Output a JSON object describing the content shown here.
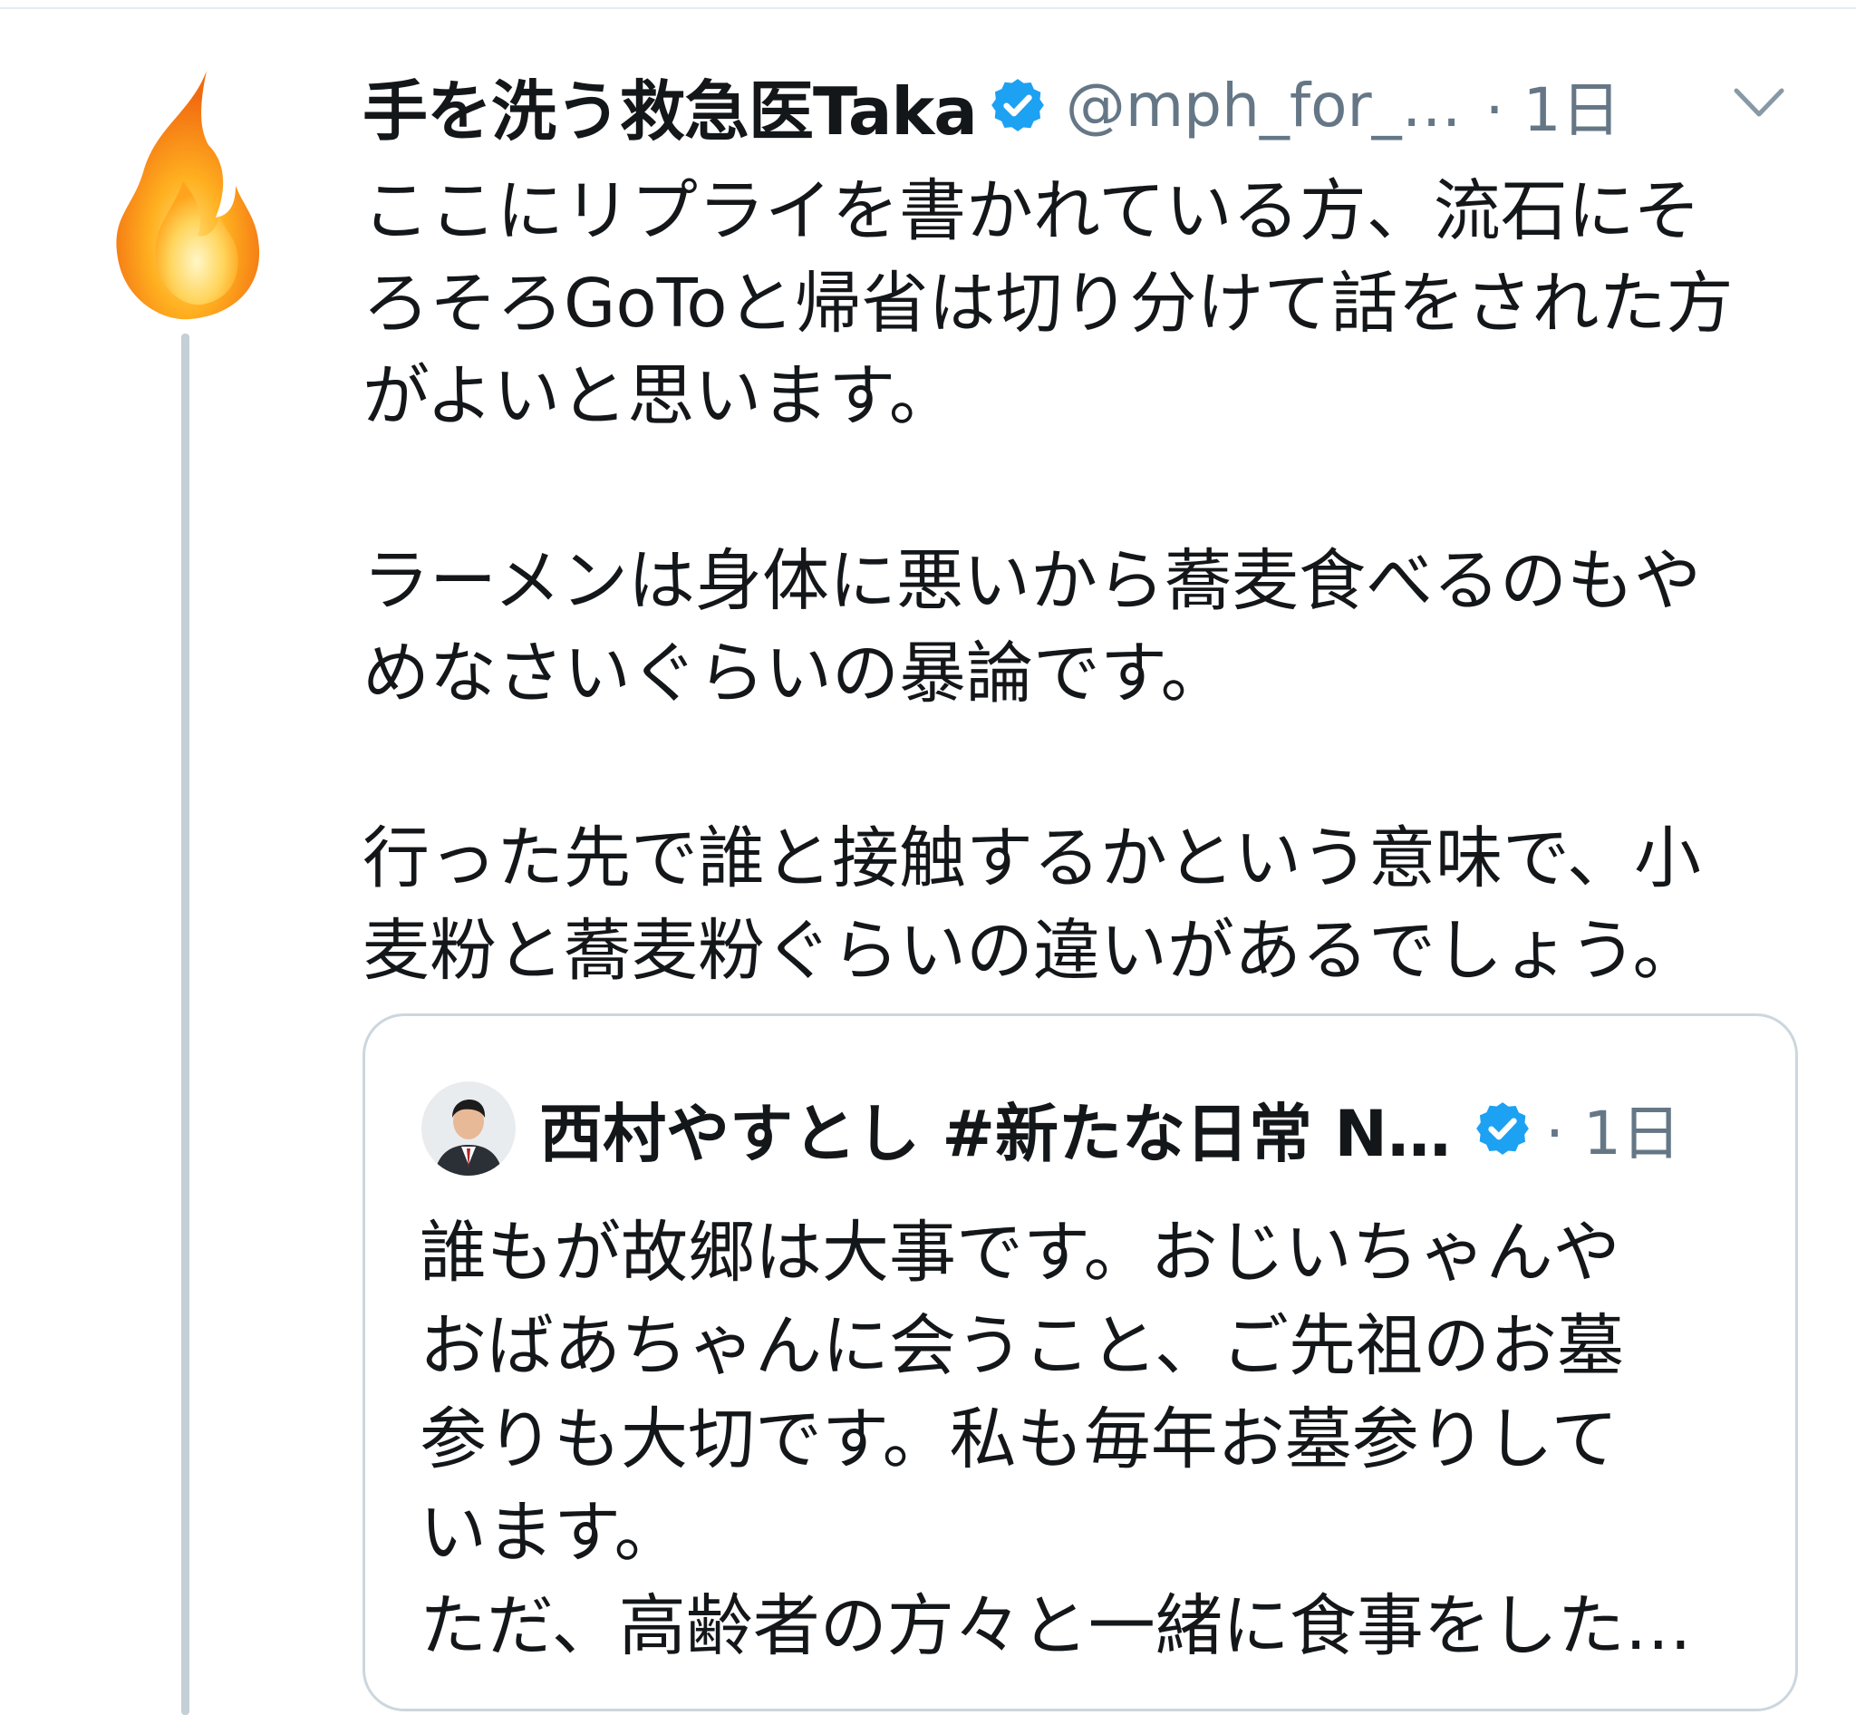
{
  "tweet": {
    "author_name": "手を洗う救急医Taka",
    "author_handle": "@mph_for_…",
    "time": "· 1日",
    "paragraphs": [
      [
        "ここにリプライを書かれている方、流石にそ",
        "ろそろGoToと帰省は切り分けて話をされた方",
        "がよいと思います。"
      ],
      [
        "ラーメンは身体に悪いから蕎麦食べるのもや",
        "めなさいぐらいの暴論です。"
      ],
      [
        "行った先で誰と接触するかという意味で、小",
        "麦粉と蕎麦粉ぐらいの違いがあるでしょう。"
      ]
    ]
  },
  "quoted_tweet": {
    "author_name": "西村やすとし #新たな日常 N…",
    "time": "· 1日",
    "lines": [
      "誰もが故郷は大事です。おじいちゃんや",
      "おばあちゃんに会うこと、ご先祖のお墓",
      "参りも大切です。私も毎年お墓参りして",
      "います。",
      "ただ、高齢者の方々と一緒に食事をした…"
    ]
  },
  "icons": {
    "author_avatar": "flame-icon",
    "verified": "verified-badge-icon",
    "menu": "chevron-down-icon",
    "quoted_avatar": "person-avatar"
  },
  "colors": {
    "verified": "#1da1f2",
    "secondary_text": "#657786",
    "thread_line": "#c4cfd6",
    "card_border": "#ccd6dd"
  }
}
